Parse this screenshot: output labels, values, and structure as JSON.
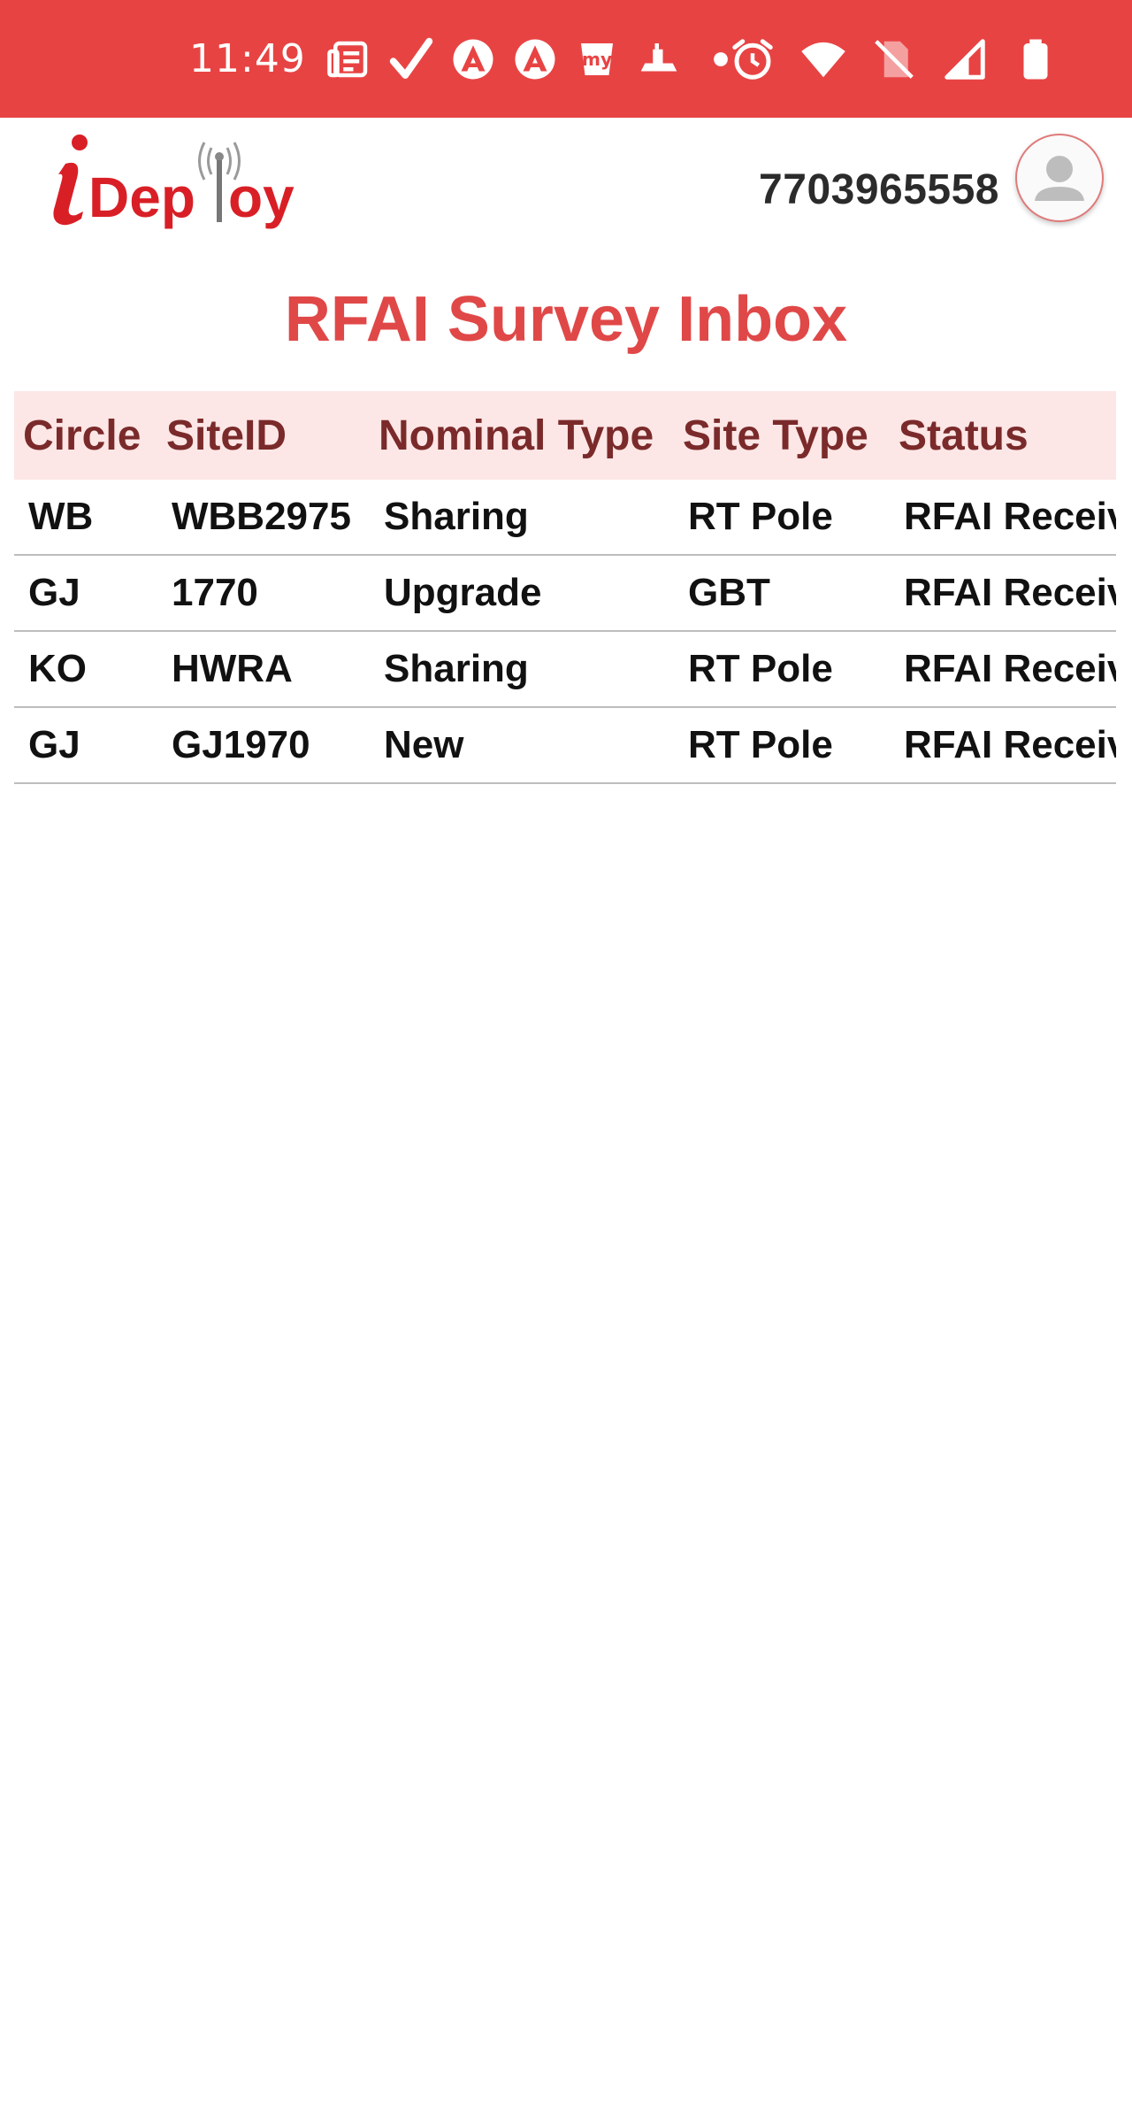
{
  "status_bar": {
    "time": "11:49",
    "left_icons": [
      "news-icon",
      "check-icon",
      "arc-app-icon",
      "arc-app-icon",
      "myntra-icon",
      "ship-icon",
      "dot-icon"
    ],
    "right_icons": [
      "alarm-icon",
      "wifi-icon",
      "no-sim-icon",
      "signal-icon",
      "battery-icon"
    ]
  },
  "header": {
    "logo_text": "iDeploy",
    "phone_number": "7703965558"
  },
  "page": {
    "title": "RFAI Survey Inbox"
  },
  "table": {
    "columns": [
      "Circle",
      "SiteID",
      "Nominal Type",
      "Site Type",
      "Status"
    ],
    "rows": [
      [
        "WB",
        "WBB2975",
        "Sharing",
        "RT Pole",
        "RFAI Receiv"
      ],
      [
        "GJ",
        "1770",
        "Upgrade",
        "GBT",
        "RFAI Receiv"
      ],
      [
        "KO",
        "HWRA",
        "Sharing",
        "RT Pole",
        "RFAI Receiv"
      ],
      [
        "GJ",
        "GJ1970",
        "New",
        "RT Pole",
        "RFAI Receiv"
      ]
    ]
  },
  "colors": {
    "status_bar": "#e84343",
    "title": "#e04848",
    "header_row_bg": "#fde6e6",
    "header_text": "#7a2a2a"
  }
}
